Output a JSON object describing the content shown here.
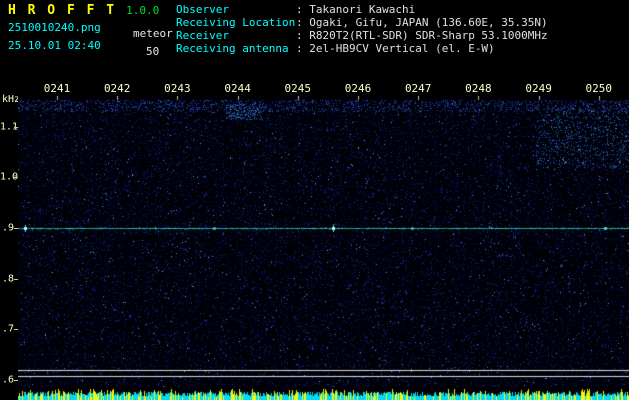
{
  "header": {
    "app_name": "H R O F F T",
    "version": "1.0.0",
    "filename": "2510010240.png",
    "mode": "meteor",
    "datetime": "25.10.01 02:40",
    "param": "50",
    "info_rows": [
      {
        "label": "Observer",
        "value": "Takanori Kawachi"
      },
      {
        "label": "Receiving Location",
        "value": "Ogaki, Gifu, JAPAN (136.60E, 35.35N)"
      },
      {
        "label": "Receiver",
        "value": "R820T2(RTL-SDR) SDR-Sharp 53.1000MHz"
      },
      {
        "label": "Receiving antenna",
        "value": "2el-HB9CV Vertical (el. E-W)"
      }
    ]
  },
  "chart_data": {
    "type": "heatmap",
    "title": "",
    "xlabel": "",
    "ylabel": "kHz",
    "x_tick_labels": [
      "0241",
      "0242",
      "0243",
      "0244",
      "0245",
      "0246",
      "0247",
      "0248",
      "0249",
      "0250"
    ],
    "y_ticks": [
      {
        "label": "1.1",
        "khz": 1.1
      },
      {
        "label": "1.0",
        "khz": 1.0
      },
      {
        "label": ".9",
        "khz": 0.9
      },
      {
        "label": ".8",
        "khz": 0.8
      },
      {
        "label": ".7",
        "khz": 0.7
      },
      {
        "label": ".6",
        "khz": 0.6
      }
    ],
    "y_range_khz": [
      0.59,
      1.16
    ],
    "time_span_minutes": 10,
    "start_time": "02:40",
    "carrier_line_khz": 0.9,
    "echo_marks": [
      {
        "min": 0.12,
        "intensity": 1.0
      },
      {
        "min": 3.2,
        "intensity": 0.55
      },
      {
        "min": 5.15,
        "intensity": 1.0
      },
      {
        "min": 6.45,
        "intensity": 0.5
      },
      {
        "min": 9.6,
        "intensity": 0.7
      }
    ],
    "separator_lines_khz": [
      0.62,
      0.61
    ],
    "legend_position": "none",
    "grid": false,
    "noise_floor": "sparse dark-blue speckle on black",
    "bottom_strip": "signal-level bars, cyan with yellow spikes"
  },
  "colors": {
    "background": "#000000",
    "title": "#ffff00",
    "version": "#00dd33",
    "cyan_text": "#00ffff",
    "white_text": "#e8e8e8",
    "axis_text": "#ffffcc",
    "carrier": "#00ffcc",
    "strip_cyan": "#00e6ff",
    "strip_yellow": "#ffff00",
    "noise_blue": "#0a1450"
  }
}
